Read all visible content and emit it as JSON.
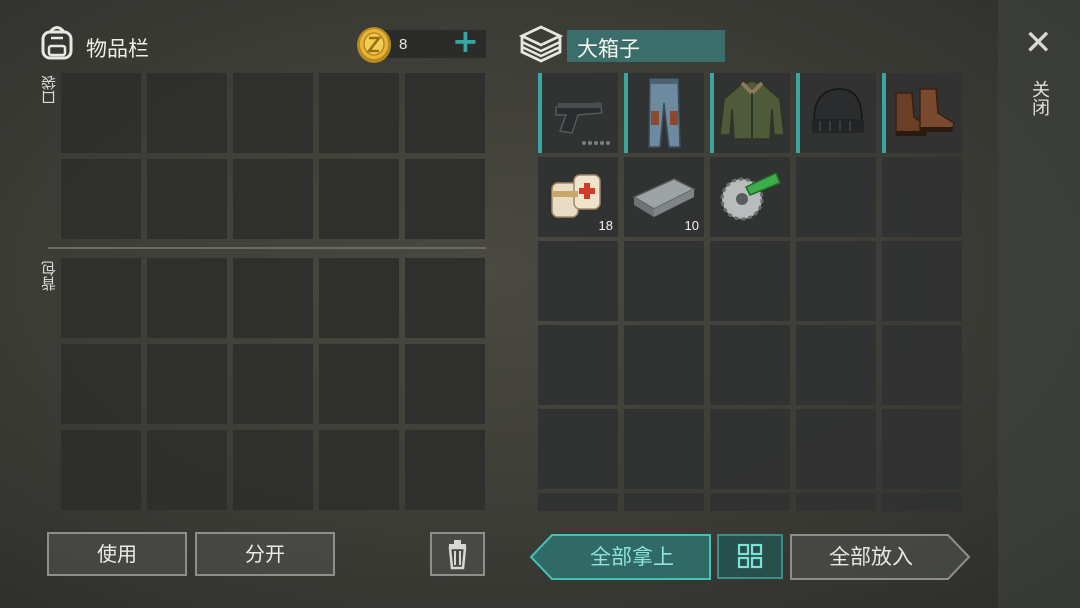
{
  "inventory": {
    "title": "物品栏",
    "pocket_label": "口袋",
    "backpack_label": "背包"
  },
  "currency": {
    "amount": "8",
    "add_symbol": "+"
  },
  "container": {
    "title": "大箱子"
  },
  "close": {
    "label": "关闭",
    "symbol": "✕"
  },
  "container_items": [
    {
      "name": "pistol",
      "qty": "",
      "equipped": true
    },
    {
      "name": "jeans",
      "qty": "",
      "equipped": true
    },
    {
      "name": "jacket",
      "qty": "",
      "equipped": true
    },
    {
      "name": "beanie",
      "qty": "",
      "equipped": true
    },
    {
      "name": "boots",
      "qty": "",
      "equipped": true
    },
    {
      "name": "bandages",
      "qty": "18",
      "equipped": false
    },
    {
      "name": "iron-bar",
      "qty": "10",
      "equipped": false
    },
    {
      "name": "saw-blade",
      "qty": "",
      "equipped": false
    }
  ],
  "buttons": {
    "use": "使用",
    "split": "分开",
    "take_all": "全部拿上",
    "put_all": "全部放入"
  },
  "colors": {
    "accent": "#3aa6a0",
    "slot": "#2e2f2d",
    "background": "#3c3c36"
  }
}
